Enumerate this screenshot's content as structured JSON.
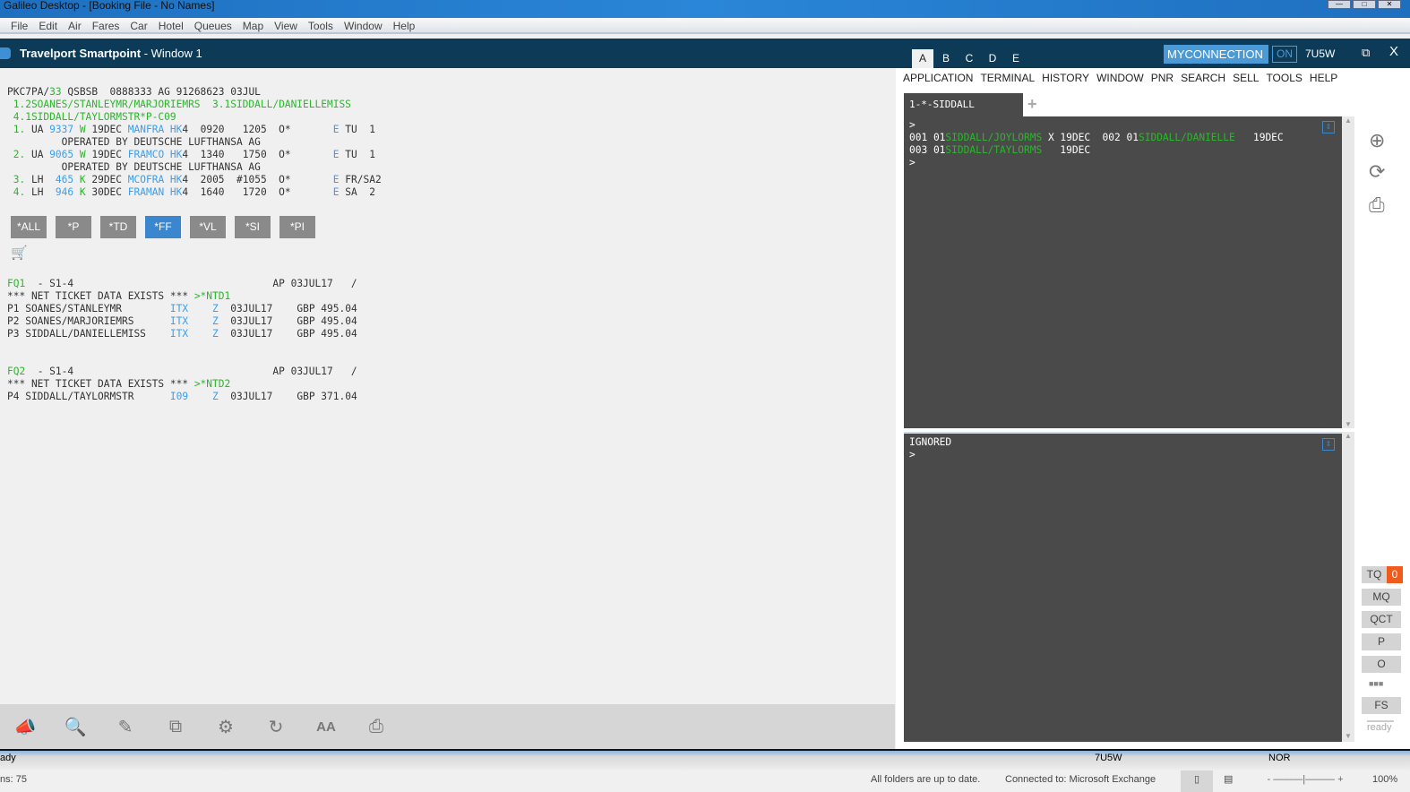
{
  "os": {
    "title": "Galileo Desktop - [Booking File - No Names]",
    "menu": [
      "File",
      "Edit",
      "Air",
      "Fares",
      "Car",
      "Hotel",
      "Queues",
      "Map",
      "View",
      "Tools",
      "Window",
      "Help"
    ]
  },
  "app": {
    "title_bold": "Travelport Smartpoint",
    "title_rest": " - Window 1",
    "areas": [
      "A",
      "B",
      "C",
      "D",
      "E"
    ],
    "connection": "MYCONNECTION",
    "on": "ON",
    "pcc": "7U5W",
    "restore": "⧉",
    "close": "X"
  },
  "pnr_lines": [
    [
      [
        "PKC7PA/",
        "d"
      ],
      [
        "33",
        "g"
      ],
      [
        " QSBSB  0888333 AG 91268623 03JUL",
        "d"
      ]
    ],
    [
      [
        " 1.2SOANES/STANLEYMR/MARJORIEMRS  3.1SIDDALL/DANIELLEMISS",
        "g"
      ]
    ],
    [
      [
        " 4.1SIDDALL/TAYLORMSTR*P-C09",
        "g"
      ]
    ],
    [
      [
        " 1.",
        "g"
      ],
      [
        " UA ",
        "d"
      ],
      [
        "9337",
        "b"
      ],
      [
        " W",
        "g"
      ],
      [
        " 19DEC ",
        "d"
      ],
      [
        "MANFRA HK",
        "b"
      ],
      [
        "4  0920   1205  O*       ",
        "d"
      ],
      [
        "E",
        "b"
      ],
      [
        " TU  1",
        "d"
      ]
    ],
    [
      [
        "         OPERATED BY DEUTSCHE LUFTHANSA AG",
        "d"
      ]
    ],
    [
      [
        " 2.",
        "g"
      ],
      [
        " UA ",
        "d"
      ],
      [
        "9065",
        "b"
      ],
      [
        " W",
        "g"
      ],
      [
        " 19DEC ",
        "d"
      ],
      [
        "FRAMCO HK",
        "b"
      ],
      [
        "4  1340   1750  O*       ",
        "d"
      ],
      [
        "E",
        "b"
      ],
      [
        " TU  1",
        "d"
      ]
    ],
    [
      [
        "         OPERATED BY DEUTSCHE LUFTHANSA AG",
        "d"
      ]
    ],
    [
      [
        " 3.",
        "g"
      ],
      [
        " LH  ",
        "d"
      ],
      [
        "465",
        "b"
      ],
      [
        " K",
        "g"
      ],
      [
        " 29DEC ",
        "d"
      ],
      [
        "MCOFRA HK",
        "b"
      ],
      [
        "4  2005  #1055  O*       ",
        "d"
      ],
      [
        "E",
        "b"
      ],
      [
        " FR/SA2",
        "d"
      ]
    ],
    [
      [
        " 4.",
        "g"
      ],
      [
        " LH  ",
        "d"
      ],
      [
        "946",
        "b"
      ],
      [
        " K",
        "g"
      ],
      [
        " 30DEC ",
        "d"
      ],
      [
        "FRAMAN HK",
        "b"
      ],
      [
        "4  1640   1720  O*       ",
        "d"
      ],
      [
        "E",
        "b"
      ],
      [
        " SA  2",
        "d"
      ]
    ]
  ],
  "display_buttons": [
    "*ALL",
    "*P",
    "*TD",
    "*FF",
    "*VL",
    "*SI",
    "*PI"
  ],
  "fare_lines": [
    [
      [
        "FQ1",
        "g"
      ],
      [
        "  - S1-4                                 AP 03JUL17   /",
        "d"
      ]
    ],
    [
      [
        "*** NET TICKET DATA EXISTS *** ",
        "d"
      ],
      [
        ">*NTD1",
        "g"
      ]
    ],
    [
      [
        "P1 SOANES/STANLEYMR        ",
        "d"
      ],
      [
        "ITX",
        "b"
      ],
      [
        "    ",
        "d"
      ],
      [
        "Z",
        "b"
      ],
      [
        "  03JUL17    GBP 495.04",
        "d"
      ]
    ],
    [
      [
        "P2 SOANES/MARJORIEMRS      ",
        "d"
      ],
      [
        "ITX",
        "b"
      ],
      [
        "    ",
        "d"
      ],
      [
        "Z",
        "b"
      ],
      [
        "  03JUL17    GBP 495.04",
        "d"
      ]
    ],
    [
      [
        "P3 SIDDALL/DANIELLEMISS    ",
        "d"
      ],
      [
        "ITX",
        "b"
      ],
      [
        "    ",
        "d"
      ],
      [
        "Z",
        "b"
      ],
      [
        "  03JUL17    GBP 495.04",
        "d"
      ]
    ],
    [
      [
        " ",
        "d"
      ]
    ],
    [
      [
        " ",
        "d"
      ]
    ],
    [
      [
        "FQ2",
        "g"
      ],
      [
        "  - S1-4                                 AP 03JUL17   /",
        "d"
      ]
    ],
    [
      [
        "*** NET TICKET DATA EXISTS *** ",
        "d"
      ],
      [
        ">*NTD2",
        "g"
      ]
    ],
    [
      [
        "P4 SIDDALL/TAYLORMSTR      ",
        "d"
      ],
      [
        "I09",
        "b"
      ],
      [
        "    ",
        "d"
      ],
      [
        "Z",
        "b"
      ],
      [
        "  03JUL17    GBP 371.04",
        "d"
      ]
    ]
  ],
  "right": {
    "menu": [
      "APPLICATION",
      "TERMINAL",
      "HISTORY",
      "WINDOW",
      "PNR",
      "SEARCH",
      "SELL",
      "TOOLS",
      "HELP"
    ],
    "session_tab": "1-*-SIDDALL",
    "add_tab": "+"
  },
  "term1_lines": [
    [
      [
        ">",
        "w"
      ]
    ],
    [
      [
        "001 01",
        "w"
      ],
      [
        "SIDDALL/JOYLORMS",
        "g"
      ],
      [
        " X 19DEC  002 01",
        "w"
      ],
      [
        "SIDDALL/DANIELLE",
        "g"
      ],
      [
        "   19DEC",
        "w"
      ]
    ],
    [
      [
        "003 01",
        "w"
      ],
      [
        "SIDDALL/TAYLORMS",
        "g"
      ],
      [
        "   19DEC",
        "w"
      ]
    ],
    [
      [
        ">",
        "w"
      ]
    ]
  ],
  "term2_lines": [
    [
      [
        "IGNORED",
        "w"
      ]
    ],
    [
      [
        ">",
        "w"
      ]
    ]
  ],
  "side": {
    "tq": "TQ",
    "tq_count": "0",
    "mq": "MQ",
    "qct": "QCT",
    "p": "P",
    "o": "O",
    "more": "■■■",
    "fs": "FS",
    "status": "ready"
  },
  "statusbar": {
    "left_cut": "ady",
    "pcc": "7U5W",
    "mode": "NOR",
    "items": "ns: 75",
    "folders": "All folders are up to date.",
    "connected": "Connected to: Microsoft Exchange",
    "zoom": "100%"
  }
}
